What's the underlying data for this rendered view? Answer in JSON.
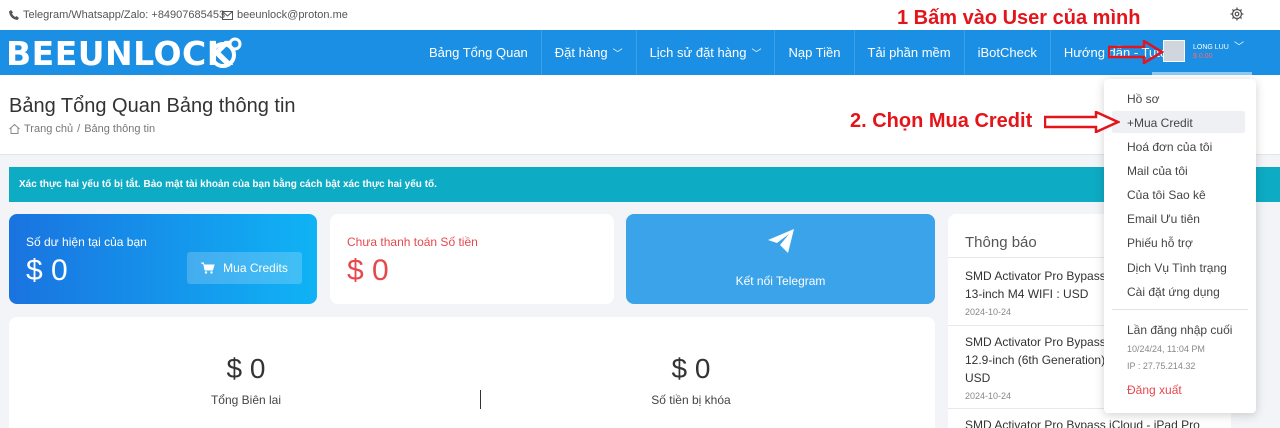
{
  "topbar": {
    "phone": "Telegram/Whatsapp/Zalo: +84907685453",
    "email": "beeunlock@proton.me"
  },
  "annotations": {
    "step1": "1 Bấm vào User của mình",
    "step2": "2. Chọn Mua Credit"
  },
  "brand": {
    "logo_text": "BEEUNLOCK"
  },
  "nav": {
    "items": [
      {
        "label": "Bảng Tổng Quan"
      },
      {
        "label": "Đặt hàng",
        "chevron": "﹀"
      },
      {
        "label": "Lịch sử đặt hàng",
        "chevron": "﹀"
      },
      {
        "label": "Nạp Tiền"
      },
      {
        "label": "Tải phần mềm"
      },
      {
        "label": "iBotCheck"
      },
      {
        "label": "Hướng dẫn - Tutorial"
      }
    ]
  },
  "user": {
    "name": "LONG LUU",
    "balance": "$ 0.00",
    "chevron": "﹀"
  },
  "page": {
    "title": "Bảng Tổng Quan Bảng thông tin",
    "breadcrumb_home": "Trang chủ",
    "breadcrumb_sep": "/",
    "breadcrumb_current": "Bảng thông tin"
  },
  "alert": {
    "text": "Xác thực hai yếu tố bị tắt. Bảo mật tài khoản của bạn bằng cách bật xác thực hai yếu tố."
  },
  "cards": {
    "balance": {
      "label": "Số dư hiện tại của bạn",
      "amount": "$ 0",
      "button": "Mua Credits"
    },
    "unpaid": {
      "label": "Chưa thanh toán Số tiền",
      "amount": "$ 0"
    },
    "telegram": {
      "label": "Kết nối Telegram"
    }
  },
  "stats": {
    "receipts": {
      "value": "$ 0",
      "label": "Tổng Biên lai"
    },
    "locked": {
      "value": "$ 0",
      "label": "Số tiền bị khóa"
    }
  },
  "notifications": {
    "heading": "Thông báo",
    "items": [
      {
        "line1": "SMD Activator Pro Bypass",
        "line2": "13-inch M4 WIFI :        USD",
        "date": "2024-10-24"
      },
      {
        "line1": "SMD Activator Pro Bypass",
        "line2": "12.9-inch (6th Generation)",
        "line3": "USD",
        "date": "2024-10-24"
      },
      {
        "line1": "SMD Activator Pro Bypass iCloud - iPad Pro"
      }
    ]
  },
  "dropdown": {
    "items": [
      "Hồ sơ",
      "+Mua Credit",
      "Hoá đơn của tôi",
      "Mail của tôi",
      "Của tôi Sao kê",
      "Email Ưu tiên",
      "Phiếu hỗ trợ",
      "Dịch Vụ Tình trạng",
      "Cài đặt ứng dụng"
    ],
    "last_login_label": "Lần đăng nhập cuối",
    "last_login_time": "10/24/24, 11:04 PM",
    "last_login_ip": "IP : 27.75.214.32",
    "logout": "Đăng xuất"
  },
  "colors": {
    "nav": "#1a8fe3",
    "alert": "#0dabc4",
    "annotation": "#e4141b",
    "danger": "#e5484d"
  }
}
